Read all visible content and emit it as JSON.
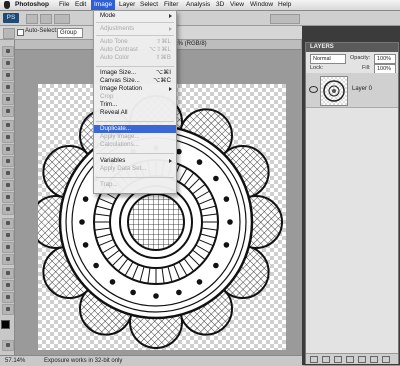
{
  "menubar": {
    "app_name": "Photoshop",
    "items": [
      "File",
      "Edit",
      "Image",
      "Layer",
      "Select",
      "Filter",
      "Analysis",
      "3D",
      "View",
      "Window",
      "Help"
    ],
    "active": "Image"
  },
  "appbar": {
    "logo": "PS"
  },
  "optbar": {
    "auto_select_label": "Auto-Select:",
    "auto_select_value": "Group"
  },
  "document": {
    "title_fragment": "57.1% (RGB/8)"
  },
  "statusbar": {
    "zoom": "57.14%",
    "message": "Exposure works in 32-bit only"
  },
  "layers_panel": {
    "title": "LAYERS",
    "blend_mode": "Normal",
    "opacity_label": "Opacity:",
    "opacity_value": "100%",
    "lock_label": "Lock:",
    "fill_label": "Fill:",
    "fill_value": "100%",
    "layer_name": "Layer 0"
  },
  "image_menu": {
    "items": [
      {
        "label": "Mode",
        "shortcut": "",
        "submenu": true,
        "disabled": false
      },
      {
        "label": "Adjustments",
        "shortcut": "",
        "submenu": true,
        "disabled": true
      },
      {
        "label": "Auto Tone",
        "shortcut": "⇧⌘L",
        "submenu": false,
        "disabled": true
      },
      {
        "label": "Auto Contrast",
        "shortcut": "⌥⇧⌘L",
        "submenu": false,
        "disabled": true
      },
      {
        "label": "Auto Color",
        "shortcut": "⇧⌘B",
        "submenu": false,
        "disabled": true
      },
      {
        "label": "Image Size...",
        "shortcut": "⌥⌘I",
        "submenu": false,
        "disabled": false
      },
      {
        "label": "Canvas Size...",
        "shortcut": "⌥⌘C",
        "submenu": false,
        "disabled": false
      },
      {
        "label": "Image Rotation",
        "shortcut": "",
        "submenu": true,
        "disabled": false
      },
      {
        "label": "Crop",
        "shortcut": "",
        "submenu": false,
        "disabled": true
      },
      {
        "label": "Trim...",
        "shortcut": "",
        "submenu": false,
        "disabled": false
      },
      {
        "label": "Reveal All",
        "shortcut": "",
        "submenu": false,
        "disabled": false
      },
      {
        "label": "Duplicate...",
        "shortcut": "",
        "submenu": false,
        "disabled": false,
        "highlighted": true
      },
      {
        "label": "Apply Image...",
        "shortcut": "",
        "submenu": false,
        "disabled": true
      },
      {
        "label": "Calculations...",
        "shortcut": "",
        "submenu": false,
        "disabled": true
      },
      {
        "label": "Variables",
        "shortcut": "",
        "submenu": true,
        "disabled": false
      },
      {
        "label": "Apply Data Set...",
        "shortcut": "",
        "submenu": false,
        "disabled": true
      },
      {
        "label": "Trap...",
        "shortcut": "",
        "submenu": false,
        "disabled": true
      }
    ]
  },
  "colors": {
    "menu_highlight": "#3a66d8",
    "disabled_text": "#a8a8a8"
  }
}
